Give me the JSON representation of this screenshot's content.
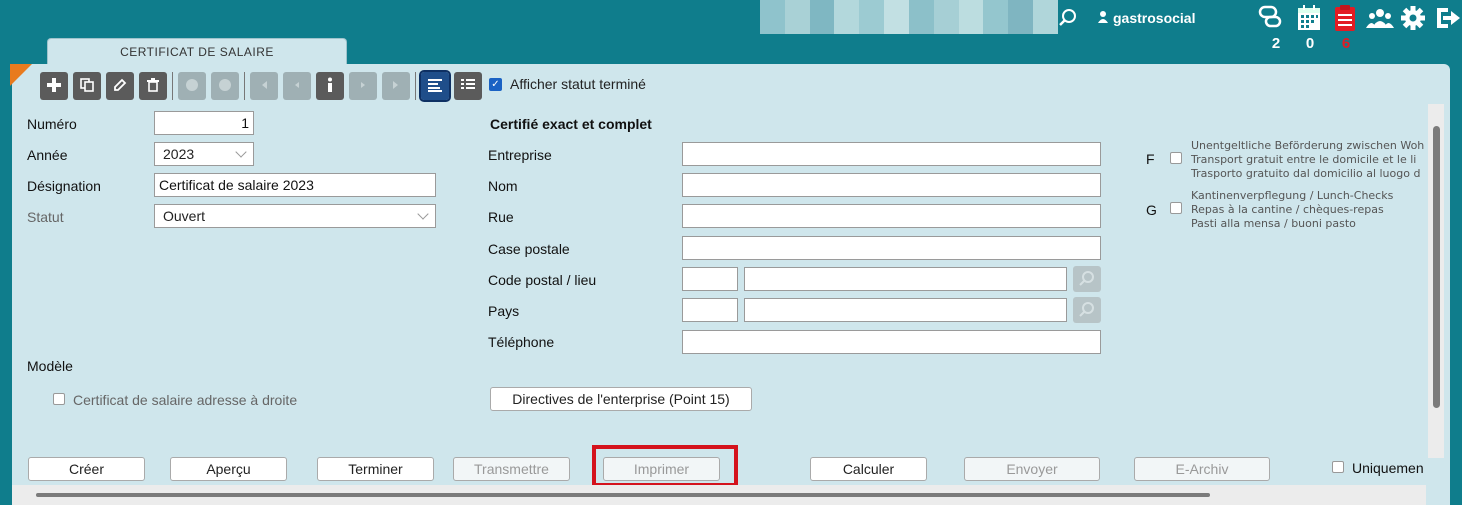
{
  "header": {
    "user_name": "gastrosocial",
    "counters": [
      {
        "icon": "chat-bubbles-icon",
        "count": "2",
        "color": "#ffffff"
      },
      {
        "icon": "calendar-icon",
        "count": "0",
        "color": "#ffffff"
      },
      {
        "icon": "clipboard-icon",
        "count": "6",
        "color": "#e31b23"
      }
    ],
    "icons": [
      "search-icon",
      "user-icon",
      "group-icon",
      "gear-icon",
      "logout-icon"
    ]
  },
  "tab": {
    "label": "CERTIFICAT DE SALAIRE"
  },
  "toolbar": {
    "buttons": [
      {
        "icon": "add-icon",
        "enabled": true
      },
      {
        "icon": "copy-icon",
        "enabled": true
      },
      {
        "icon": "edit-icon",
        "enabled": true
      },
      {
        "icon": "trash-icon",
        "enabled": true
      },
      {
        "icon": "check-icon",
        "enabled": false
      },
      {
        "icon": "cancel-icon",
        "enabled": false
      },
      {
        "icon": "first-icon",
        "enabled": false
      },
      {
        "icon": "prev-icon",
        "enabled": false
      },
      {
        "icon": "info-icon",
        "enabled": true
      },
      {
        "icon": "next-icon",
        "enabled": false
      },
      {
        "icon": "last-icon",
        "enabled": false
      },
      {
        "icon": "form-view-icon",
        "enabled": true,
        "selected": true
      },
      {
        "icon": "list-view-icon",
        "enabled": true
      }
    ]
  },
  "status_filter": {
    "label": "Afficher statut terminé",
    "checked": true
  },
  "form": {
    "numero_label": "Numéro",
    "numero_value": "1",
    "annee_label": "Année",
    "annee_value": "2023",
    "designation_label": "Désignation",
    "designation_value": "Certificat de salaire 2023",
    "statut_label": "Statut",
    "statut_value": "Ouvert",
    "modele_label": "Modèle",
    "adresse_droite_label": "Certificat de salaire adresse à droite"
  },
  "certifie": {
    "title": "Certifié exact et complet",
    "entreprise_label": "Entreprise",
    "nom_label": "Nom",
    "rue_label": "Rue",
    "case_postale_label": "Case postale",
    "code_postal_label": "Code postal / lieu",
    "pays_label": "Pays",
    "telephone_label": "Téléphone",
    "directives_button": "Directives de l'enterprise (Point 15)"
  },
  "options": {
    "f_letter": "F",
    "f_lines": [
      "Unentgeltliche Beförderung zwischen Woh",
      "Transport gratuit entre le domicile et le li",
      "Trasporto gratuito dal domicilio al luogo d"
    ],
    "g_letter": "G",
    "g_lines": [
      "Kantinenverpflegung / Lunch-Checks",
      "Repas à la cantine / chèques-repas",
      "Pasti alla mensa / buoni pasto"
    ]
  },
  "actions": {
    "creer": "Créer",
    "apercu": "Aperçu",
    "terminer": "Terminer",
    "transmettre": "Transmettre",
    "imprimer": "Imprimer",
    "calculer": "Calculer",
    "envoyer": "Envoyer",
    "earchiv": "E-Archiv",
    "uniquement": "Uniquemen"
  },
  "colors": {
    "header_bg": "#0f7d8c",
    "panel_bg": "#cfe6ec",
    "highlight": "#d4121c",
    "accent": "#e87b1e"
  }
}
